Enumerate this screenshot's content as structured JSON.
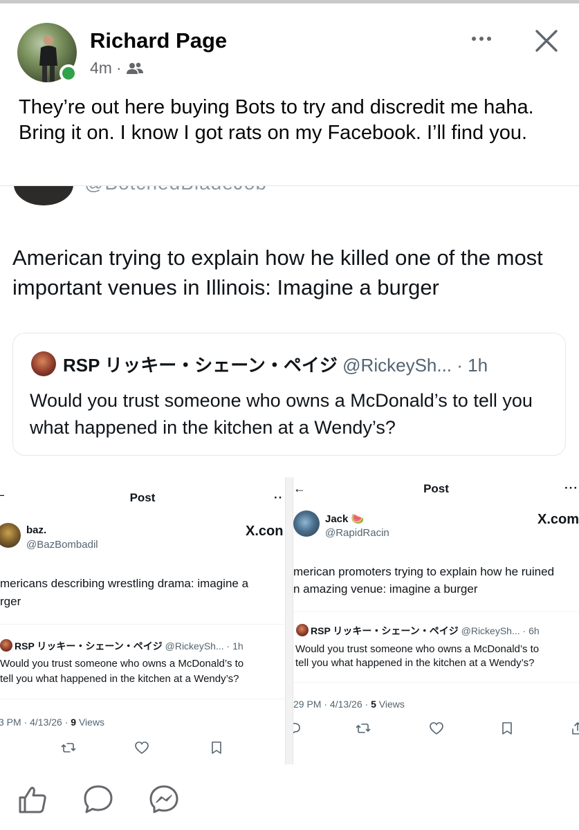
{
  "post": {
    "author": "Richard Page",
    "time": "4m",
    "separator": "·",
    "text": "They’re out here buying Bots to try and discredit me haha. Bring it on. I know I got rats on my Facebook. I’ll find you."
  },
  "tweet": {
    "handle_partial": "@BotchedBladeJob",
    "text": "American trying to explain how he killed one of the most important venues in Illinois: Imagine a burger",
    "quote": {
      "name": "RSP リッキー・シェーン・ペイジ",
      "handle_time": "@RickeySh... · 1h",
      "text": "Would you trust someone who owns a McDonald’s to tell you what happened in the kitchen at a Wendy’s?"
    }
  },
  "left_shot": {
    "title": "Post",
    "dots": "··",
    "name": "baz.",
    "handle": "@BazBombadil",
    "x_label": "X.con",
    "text_line1": "mericans describing wrestling drama: imagine a",
    "text_line2": "rger",
    "quote_name": "RSP リッキー・シェーン・ペイジ",
    "quote_handle_time": "@RickeySh... · 1h",
    "quote_line1": "Would you trust someone who owns a McDonald’s to",
    "quote_line2": "tell you what happened in the kitchen at a Wendy’s?",
    "meta_time": "3 PM · 4/13/26 ·",
    "meta_views_count": "9",
    "meta_views_label": "Views"
  },
  "right_shot": {
    "title": "Post",
    "back": "←",
    "dots": "···",
    "name": "Jack 🍉",
    "handle": "@RapidRacin",
    "x_label": "X.com",
    "text_line1": "merican promoters trying to explain how he ruined",
    "text_line2": "n amazing venue: imagine a burger",
    "quote_name": "RSP リッキー・シェーン・ペイジ",
    "quote_handle_time": "@RickeySh... · 6h",
    "quote_line1": "Would you trust someone who owns a McDonald’s to",
    "quote_line2": "tell you what happened in the kitchen at a Wendy’s?",
    "meta_time": "29 PM · 4/13/26 ·",
    "meta_views_count": "5",
    "meta_views_label": "Views"
  },
  "icons": {
    "fb_actions": [
      "like-icon",
      "comment-icon",
      "messenger-icon"
    ],
    "tw_actions": [
      "reply-icon",
      "retweet-icon",
      "like-heart-icon",
      "bookmark-icon",
      "share-icon"
    ]
  },
  "colors": {
    "online": "#31a24c",
    "text": "#050505",
    "secondary": "#65676b",
    "tw_secondary": "#536471"
  }
}
